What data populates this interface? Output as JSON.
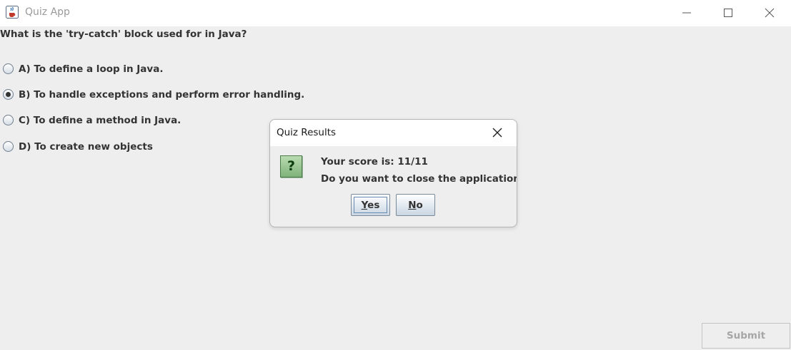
{
  "window": {
    "title": "Quiz App",
    "icon": "java-cup-icon",
    "controls": [
      "minimize-icon",
      "maximize-icon",
      "close-icon"
    ]
  },
  "quiz": {
    "question": "What is the 'try-catch' block used for in Java?",
    "options": [
      {
        "label": "A) To define a loop in Java.",
        "selected": false
      },
      {
        "label": "B) To handle exceptions and perform error handling.",
        "selected": true
      },
      {
        "label": "C) To define a method in Java.",
        "selected": false
      },
      {
        "label": "D) To create new objects",
        "selected": false
      }
    ],
    "submit_label": "Submit",
    "submit_enabled": false
  },
  "dialog": {
    "title": "Quiz Results",
    "icon": "question-icon",
    "icon_glyph": "?",
    "score_line": "Your score is: 11/11",
    "prompt": "Do you want to close the application?",
    "yes": {
      "mnemonic": "Y",
      "rest": "es"
    },
    "no": {
      "mnemonic": "N",
      "rest": "o"
    }
  },
  "colors": {
    "background": "#eeeeee",
    "text": "#333333",
    "disabled_text": "#a6a6a6",
    "question_icon": "#7fb27a"
  }
}
